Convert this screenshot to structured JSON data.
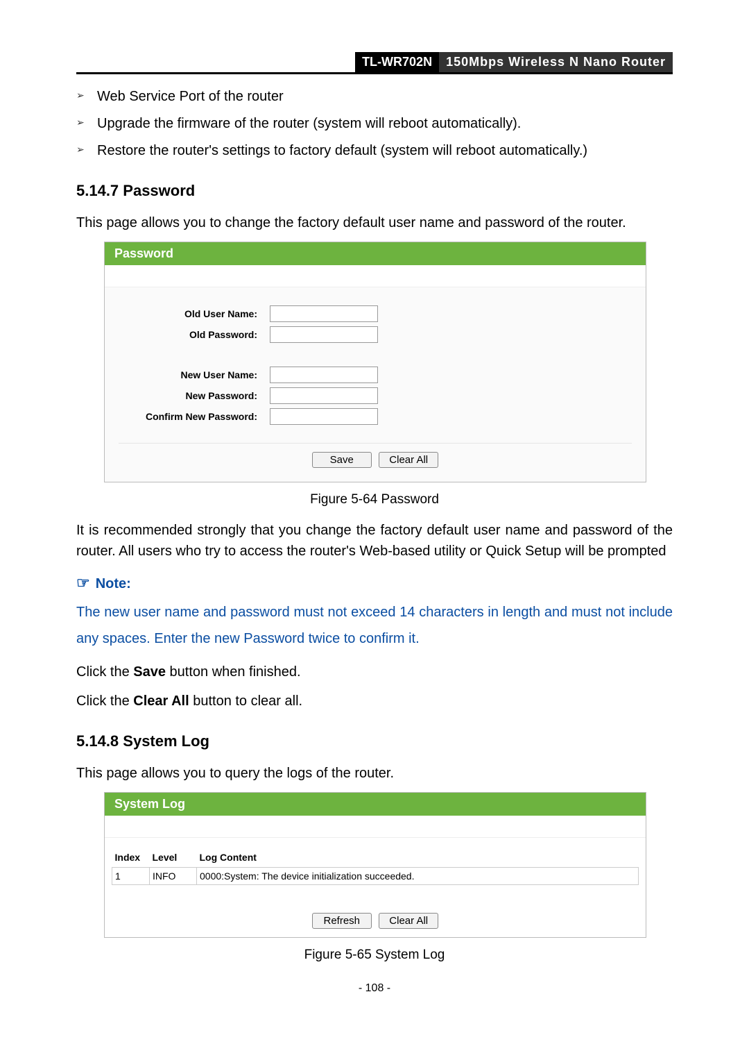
{
  "header": {
    "model": "TL-WR702N",
    "desc": "150Mbps Wireless N Nano Router"
  },
  "bullets": [
    "Web Service Port of the router",
    "Upgrade the firmware of the router (system will reboot automatically).",
    "Restore the router's settings to factory default (system will reboot automatically.)"
  ],
  "sec_password": {
    "heading": "5.14.7  Password",
    "intro": "This page allows you to change the factory default user name and password of the router.",
    "panel_title": "Password",
    "labels": {
      "old_user": "Old User Name:",
      "old_pass": "Old Password:",
      "new_user": "New User Name:",
      "new_pass": "New Password:",
      "confirm": "Confirm New Password:"
    },
    "buttons": {
      "save": "Save",
      "clear": "Clear All"
    },
    "caption": "Figure 5-64 Password",
    "recommend": "It is recommended strongly that you change the factory default user name and password of the router. All users who try to access the router's Web-based utility or Quick Setup will be prompted",
    "note_label": "Note:",
    "note_body": "The new user name and password must not exceed 14 characters in length and must not include any spaces. Enter the new Password twice to confirm it.",
    "save_line_pre": "Click the ",
    "save_line_bold": "Save",
    "save_line_post": " button when finished.",
    "clear_line_pre": "Click the ",
    "clear_line_bold": "Clear All",
    "clear_line_post": " button to clear all."
  },
  "sec_log": {
    "heading": "5.14.8  System Log",
    "intro": "This page allows you to query the logs of the router.",
    "panel_title": "System Log",
    "cols": {
      "index": "Index",
      "level": "Level",
      "content": "Log Content"
    },
    "rows": [
      {
        "index": "1",
        "level": "INFO",
        "content": "0000:System: The device initialization succeeded."
      }
    ],
    "buttons": {
      "refresh": "Refresh",
      "clear": "Clear All"
    },
    "caption": "Figure 5-65    System Log"
  },
  "page_num": "- 108 -"
}
